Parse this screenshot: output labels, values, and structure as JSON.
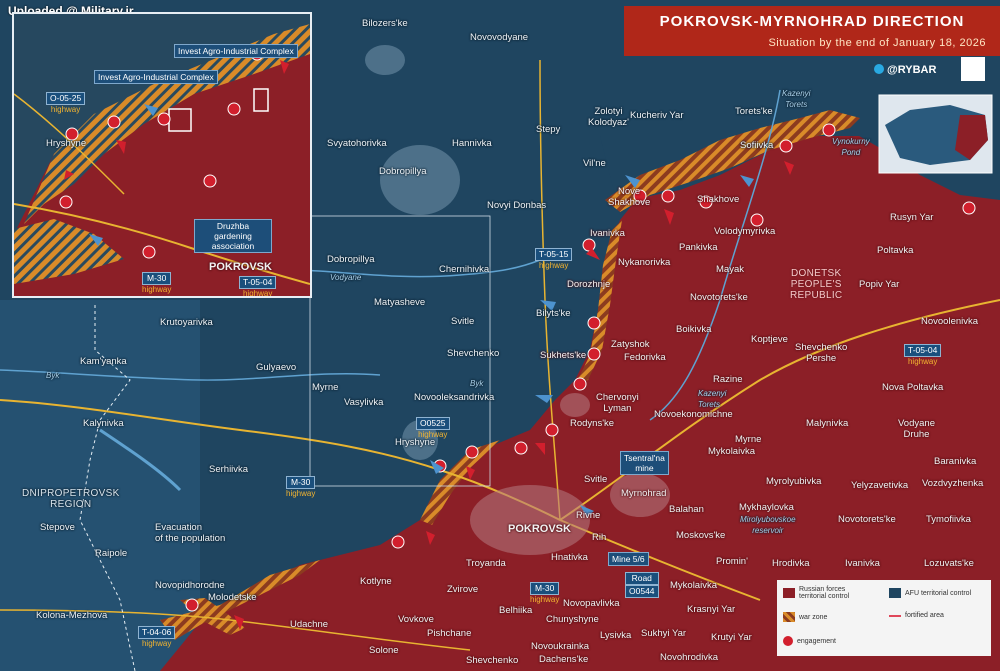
{
  "watermark": "Uploaded @ Military.ir",
  "header": {
    "title": "POKROVSK-MYRNOHRAD DIRECTION",
    "subtitle": "Situation by the end of January 18, 2026",
    "brand": "@RYBAR",
    "brand_icon": "telegram-icon"
  },
  "colors": {
    "afu_control": "#1f4560",
    "russian_control": "#8c1f27",
    "war_zone": "#d98b29",
    "fortified": "#e0475a",
    "engagement": "#d21f2d",
    "title_bg": "#b02719",
    "highway": "#e8b431"
  },
  "inset": {
    "labels": {
      "invest1": "Invest Agro-Industrial Complex",
      "invest2": "Invest Agro-Industrial Complex",
      "hryshyne": "Hryshyne",
      "druzhba": "Druzhba gardening association",
      "pokrovsk": "POKROVSK"
    },
    "highways": {
      "o0525": {
        "code": "O-05-25",
        "type": "highway"
      },
      "m30": {
        "code": "M-30",
        "type": "highway"
      },
      "t0504": {
        "code": "T-05-04",
        "type": "highway"
      }
    }
  },
  "places": {
    "bilozerske": "Bilozers'ke",
    "novovodyane": "Novovodyane",
    "zolotyi": "Zolotyi\nKolodyaz'",
    "kucheriv_yar": "Kucheriv Yar",
    "toretske": "Torets'ke",
    "svyatohorivka": "Svyatohorivka",
    "hannivka": "Hannivka",
    "stepy": "Stepy",
    "sofiivka": "Sofiivka",
    "dobropillya1": "Dobropillya",
    "vilne": "Vil'ne",
    "nove_shakhove": "Nove\nShakhove",
    "shakhove": "Shakhove",
    "novyi_donbas": "Novyi Donbas",
    "ivanivka_n": "Ivanivka",
    "volodymyrivka": "Volodymyrivka",
    "rusyn_yar": "Rusyn Yar",
    "pankivka": "Pankivka",
    "poltavka": "Poltavka",
    "dobropillya2": "Dobropillya",
    "nykanorivka": "Nykanorivka",
    "chernihivka": "Chernihivka",
    "mayak": "Mayak",
    "dorozhnje": "Dorozhnje",
    "popiv_yar": "Popiv Yar",
    "matyasheve": "Matyasheve",
    "novotoretske_n": "Novotorets'ke",
    "bilytske": "Bilyts'ke",
    "krutoyarivka": "Krutoyarivka",
    "svitle_n": "Svitle",
    "boikivka": "Boikivka",
    "novoolenivka": "Novoolenivka",
    "zatyshok": "Zatyshok",
    "koptjeve": "Koptjeve",
    "shevchenko_n": "Shevchenko",
    "sukhetske": "Sukhets'ke",
    "fedorivka": "Fedorivka",
    "shevchenko_pershe": "Shevchenko\nPershe",
    "kamyanka": "Kam'yanka",
    "gulyaevo": "Gulyaevo",
    "razine": "Razine",
    "nova_poltavka": "Nova Poltavka",
    "myrne_w": "Myrne",
    "chervonyi_lyman": "Chervonyi\nLyman",
    "vasylivka": "Vasylivka",
    "novooleksandrivka": "Novooleksandrivka",
    "novoekonomichne": "Novoekonomichne",
    "kalynivka": "Kalynivka",
    "rodynske": "Rodyns'ke",
    "malynivka": "Malynivka",
    "vodyane_druhe": "Vodyane\nDruhe",
    "myrne_e": "Myrne",
    "mykolaivka_e": "Mykolaivka",
    "baranivka": "Baranivka",
    "hryshyne": "Hryshyne",
    "serhiivka": "Serhiivka",
    "myrolyubivka": "Myrolyubivka",
    "yelyzavetivka": "Yelyzavetivka",
    "svitle_s": "Svitle",
    "myrnohrad": "Myrnohrad",
    "vozdvyzhenka": "Vozdvyzhenka",
    "mykhaylovka": "Mykhaylovka",
    "balahan": "Balahan",
    "novotoretske_s": "Novotorets'ke",
    "tymofiivka": "Tymofiivka",
    "pokrovsk": "POKROVSK",
    "rivne": "Rivne",
    "stepove": "Stepove",
    "moskovske": "Moskovs'ke",
    "rih": "Rih",
    "hnativka": "Hnativka",
    "raipole": "Raipole",
    "troyanda": "Troyanda",
    "promin": "Promin'",
    "hrodivka": "Hrodivka",
    "ivanivka_s": "Ivanivka",
    "lozuvatske": "Lozuvats'ke",
    "novopidhorodne": "Novopidhorodne",
    "kotlyne": "Kotlyne",
    "zvirove": "Zvirove",
    "molodetske": "Molodetske",
    "mykolaivka_s": "Mykolaivka",
    "kolona_mezhova": "Kolona-Mezhova",
    "belhiika": "Belhiika",
    "novopavlivka": "Novopavlivka",
    "krasnyi_yar": "Krasnyi Yar",
    "udachne": "Udachne",
    "vovkove": "Vovkove",
    "chunyshyne": "Chunyshyne",
    "pishchane": "Pishchane",
    "lysivka": "Lysivka",
    "sukhyi_yar": "Sukhyi Yar",
    "krutyi_yar": "Krutyi Yar",
    "solone": "Solone",
    "novoukrainka": "Novoukrainka",
    "shevchenko_s": "Shevchenko",
    "dachenske": "Dachens'ke",
    "novohrodivka": "Novohrodivka"
  },
  "regions": {
    "donetsk": "DONETSK\nPEOPLE'S\nREPUBLIC",
    "dnipropetrovsk": "DNIPROPETROVSK\nREGION"
  },
  "water": {
    "kazenyi_torets_n": "Kazenyi\nTorets",
    "vynokurny": "Vynokurny\nPond",
    "kazenyi_torets_s": "Kazenyi\nTorets",
    "vodyane": "Vodyane",
    "byk": "Byk",
    "byk2": "Byk",
    "myrolyubovskoe": "Mirolyubovskoe\nreservoir"
  },
  "highways": {
    "t0515": {
      "code": "T-05-15",
      "type": "highway"
    },
    "t0504_e": {
      "code": "T-05-04",
      "type": "highway"
    },
    "o0525": {
      "code": "O0525",
      "type": "highway"
    },
    "m30_w": {
      "code": "M-30",
      "type": "highway"
    },
    "m30_s": {
      "code": "M-30",
      "type": "highway"
    },
    "t0406": {
      "code": "T-04-06",
      "type": "highway"
    },
    "road_o0544": {
      "code": "Road",
      "type": "O0544"
    }
  },
  "callouts": {
    "evacuation": "Evacuation\nof the population",
    "tsentralna": "Tsentral'na\nmine",
    "mine56": "Mine 5/6"
  },
  "legend": {
    "russian": "Russian forces\nterritorial control",
    "afu": "AFU territorial control",
    "war_zone": "war zone",
    "fortified": "fortified area",
    "engagement": "engagement"
  }
}
